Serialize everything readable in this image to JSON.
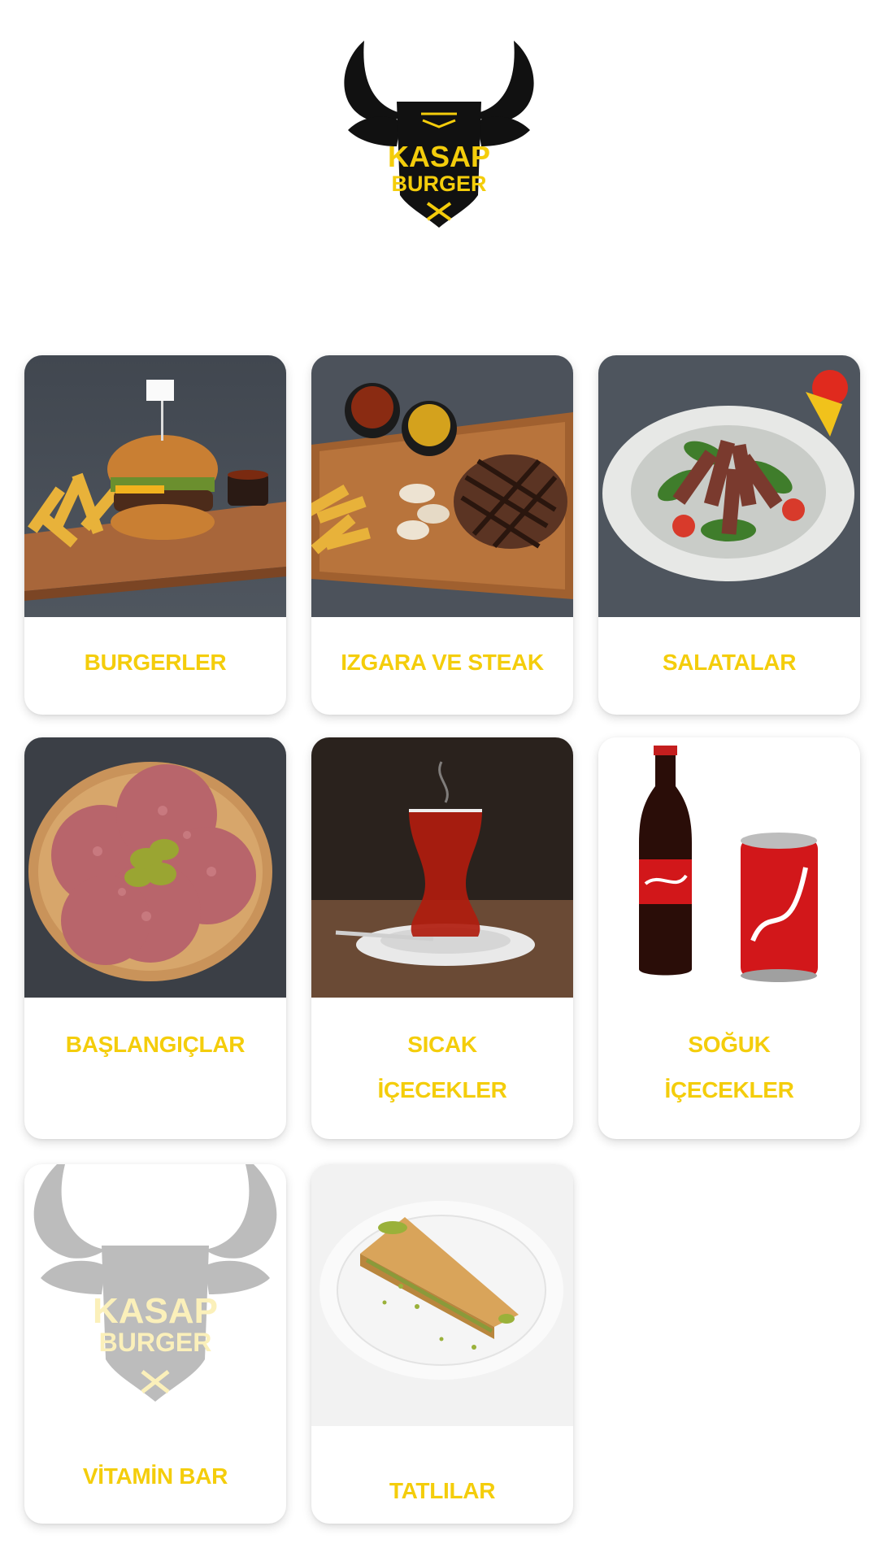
{
  "brand": {
    "name_line1": "KASAP",
    "name_line2": "BURGER",
    "accent_color": "#f4cd0b",
    "logo_color": "#111111"
  },
  "categories": [
    {
      "label": "BURGERLER",
      "icon": "burger-with-fries"
    },
    {
      "label": "IZGARA VE STEAK",
      "icon": "grilled-steak"
    },
    {
      "label": "SALATALAR",
      "icon": "steak-salad"
    },
    {
      "label": "BAŞLANGIÇLAR",
      "icon": "salami-plate"
    },
    {
      "label_line1": "SICAK",
      "label_line2": "İÇECEKLER",
      "icon": "turkish-tea"
    },
    {
      "label_line1": "SOĞUK",
      "label_line2": "İÇECEKLER",
      "icon": "cola-bottle-and-can"
    },
    {
      "label": "VİTAMİN BAR",
      "icon": "kasap-burger-placeholder-logo"
    },
    {
      "label": "TATLILAR",
      "icon": "baklava"
    }
  ]
}
